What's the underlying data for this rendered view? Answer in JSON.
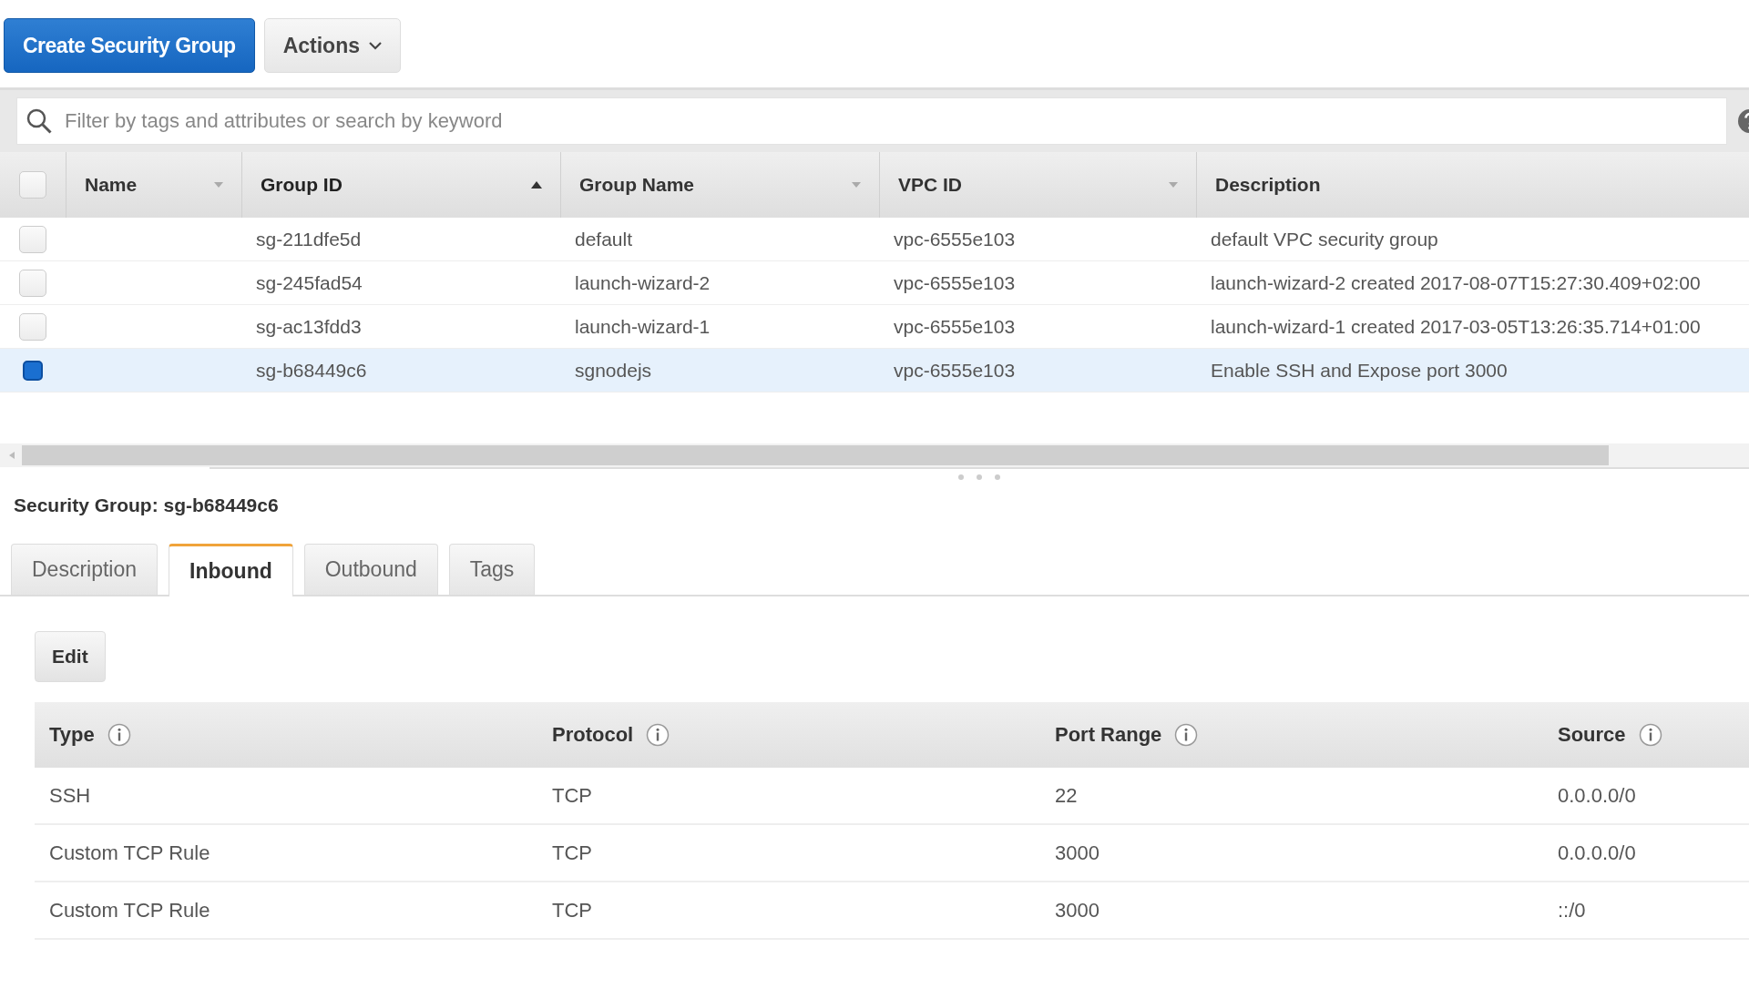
{
  "toolbar": {
    "create_button": "Create Security Group",
    "actions_button": "Actions"
  },
  "search": {
    "placeholder": "Filter by tags and attributes or search by keyword"
  },
  "table": {
    "select_all": {
      "checked": false
    },
    "columns": [
      {
        "label": "Name",
        "sortable": true,
        "sorted": false
      },
      {
        "label": "Group ID",
        "sortable": true,
        "sorted": true
      },
      {
        "label": "Group Name",
        "sortable": true,
        "sorted": false
      },
      {
        "label": "VPC ID",
        "sortable": true,
        "sorted": false
      },
      {
        "label": "Description",
        "sortable": false,
        "sorted": false
      }
    ],
    "rows": [
      {
        "selected": false,
        "cells": [
          "",
          "sg-211dfe5d",
          "default",
          "vpc-6555e103",
          "default VPC security group"
        ]
      },
      {
        "selected": false,
        "cells": [
          "",
          "sg-245fad54",
          "launch-wizard-2",
          "vpc-6555e103",
          "launch-wizard-2 created 2017-08-07T15:27:30.409+02:00"
        ]
      },
      {
        "selected": false,
        "cells": [
          "",
          "sg-ac13fdd3",
          "launch-wizard-1",
          "vpc-6555e103",
          "launch-wizard-1 created 2017-03-05T13:26:35.714+01:00"
        ]
      },
      {
        "selected": true,
        "cells": [
          "",
          "sg-b68449c6",
          "sgnodejs",
          "vpc-6555e103",
          "Enable SSH and Expose port 3000"
        ]
      }
    ]
  },
  "details": {
    "title": "Security Group: sg-b68449c6",
    "tabs": [
      {
        "label": "Description",
        "selected": false
      },
      {
        "label": "Inbound",
        "selected": true
      },
      {
        "label": "Outbound",
        "selected": false
      },
      {
        "label": "Tags",
        "selected": false
      }
    ],
    "edit_button": "Edit",
    "rules": {
      "columns": [
        "Type",
        "Protocol",
        "Port Range",
        "Source"
      ],
      "rows": [
        [
          "SSH",
          "TCP",
          "22",
          "0.0.0.0/0"
        ],
        [
          "Custom TCP Rule",
          "TCP",
          "3000",
          "0.0.0.0/0"
        ],
        [
          "Custom TCP Rule",
          "TCP",
          "3000",
          "::/0"
        ]
      ]
    }
  }
}
